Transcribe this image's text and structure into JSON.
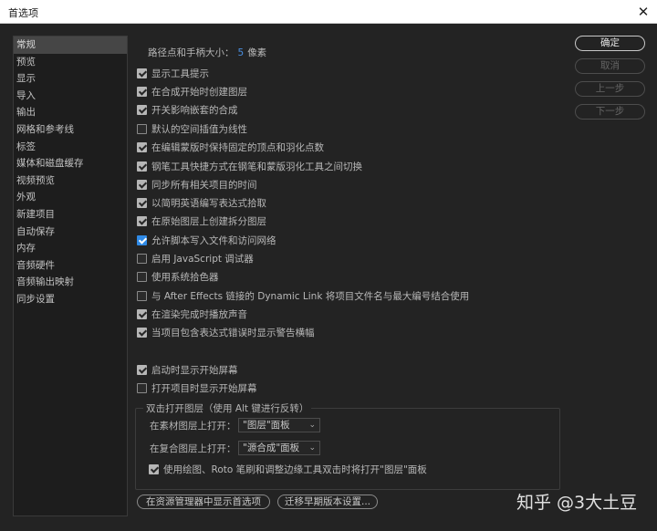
{
  "window": {
    "title": "首选项",
    "close_glyph": "✕"
  },
  "sidebar": {
    "items": [
      "常规",
      "预览",
      "显示",
      "导入",
      "输出",
      "网格和参考线",
      "标签",
      "媒体和磁盘缓存",
      "视频预览",
      "外观",
      "新建项目",
      "自动保存",
      "内存",
      "音频硬件",
      "音频输出映射",
      "同步设置"
    ],
    "active_index": 0
  },
  "general": {
    "path_size_label": "路径点和手柄大小：",
    "path_size_value": "5",
    "path_size_unit": "像素",
    "options": [
      {
        "label": "显示工具提示",
        "checked": true
      },
      {
        "label": "在合成开始时创建图层",
        "checked": true
      },
      {
        "label": "开关影响嵌套的合成",
        "checked": true
      },
      {
        "label": "默认的空间插值为线性",
        "checked": false
      },
      {
        "label": "在编辑蒙版时保持固定的顶点和羽化点数",
        "checked": true
      },
      {
        "label": "钢笔工具快捷方式在钢笔和蒙版羽化工具之间切换",
        "checked": true
      },
      {
        "label": "同步所有相关项目的时间",
        "checked": true
      },
      {
        "label": "以简明英语编写表达式拾取",
        "checked": true
      },
      {
        "label": "在原始图层上创建拆分图层",
        "checked": true
      },
      {
        "label": "允许脚本写入文件和访问网络",
        "checked": true
      },
      {
        "label": "启用 JavaScript 调试器",
        "checked": false
      },
      {
        "label": "使用系统拾色器",
        "checked": false
      },
      {
        "label": "与 After Effects 链接的 Dynamic Link 将项目文件名与最大编号结合使用",
        "checked": false
      },
      {
        "label": "在渲染完成时播放声音",
        "checked": true
      },
      {
        "label": "当项目包含表达式错误时显示警告横幅",
        "checked": true
      }
    ],
    "startup_options": [
      {
        "label": "启动时显示开始屏幕",
        "checked": true
      },
      {
        "label": "打开项目时显示开始屏幕",
        "checked": false
      }
    ],
    "double_click_group": {
      "legend": "双击打开图层（使用 Alt 键进行反转）",
      "footage_label": "在素材图层上打开：",
      "footage_value": "\"图层\"面板",
      "comp_label": "在复合图层上打开：",
      "comp_value": "\"源合成\"面板",
      "paint_option": {
        "label": "使用绘图、Roto 笔刷和调整边缘工具双击时将打开\"图层\"面板",
        "checked": true
      }
    },
    "bottom_buttons": {
      "reveal": "在资源管理器中显示首选项",
      "migrate": "迁移早期版本设置..."
    }
  },
  "buttons": {
    "ok": "确定",
    "cancel": "取消",
    "prev": "上一步",
    "next": "下一步"
  },
  "watermark": "知乎 @3大土豆",
  "colors": {
    "background": "#232323",
    "accent": "#4a90e2",
    "checkbox_checked": "#b6b6b6",
    "checkbox_blue": "#2f8ae6"
  }
}
